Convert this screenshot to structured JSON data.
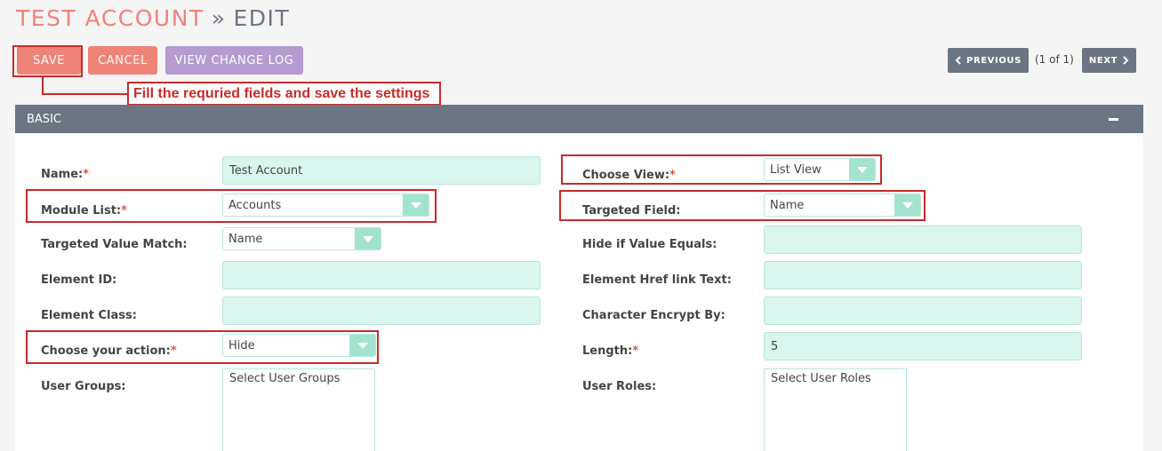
{
  "header": {
    "module": "TEST ACCOUNT",
    "separator": "»",
    "action": "EDIT"
  },
  "toolbar": {
    "save_label": "SAVE",
    "cancel_label": "CANCEL",
    "view_log_label": "VIEW CHANGE LOG"
  },
  "pagination": {
    "previous_label": "PREVIOUS",
    "count": "(1 of 1)",
    "next_label": "NEXT"
  },
  "annotation": {
    "text": "Fill the requried fields and save the settings",
    "color": "#c92a2a"
  },
  "panel": {
    "title": "BASIC"
  },
  "form": {
    "required_mark": "*",
    "name": {
      "label": "Name:",
      "value": "Test Account"
    },
    "module_list": {
      "label": "Module List:",
      "value": "Accounts"
    },
    "targeted_value_match": {
      "label": "Targeted Value Match:",
      "value": "Name"
    },
    "element_id": {
      "label": "Element ID:",
      "value": ""
    },
    "element_class": {
      "label": "Element Class:",
      "value": ""
    },
    "choose_action": {
      "label": "Choose your action:",
      "value": "Hide"
    },
    "user_groups": {
      "label": "User Groups:",
      "value": "Select User Groups"
    },
    "choose_view": {
      "label": "Choose View:",
      "value": "List View"
    },
    "targeted_field": {
      "label": "Targeted Field:",
      "value": "Name"
    },
    "hide_if_value": {
      "label": "Hide if Value Equals:",
      "value": ""
    },
    "element_href": {
      "label": "Element Href link Text:",
      "value": ""
    },
    "char_encrypt": {
      "label": "Character Encrypt By:",
      "value": ""
    },
    "length": {
      "label": "Length:",
      "value": "5"
    },
    "user_roles": {
      "label": "User Roles:",
      "value": "Select User Roles"
    }
  },
  "colors": {
    "accent": "#f08377",
    "secondary": "#b49bd0",
    "header_bar": "#6b7682",
    "field_bg": "#d9f6ee",
    "select_arrow": "#a2e3cf"
  }
}
